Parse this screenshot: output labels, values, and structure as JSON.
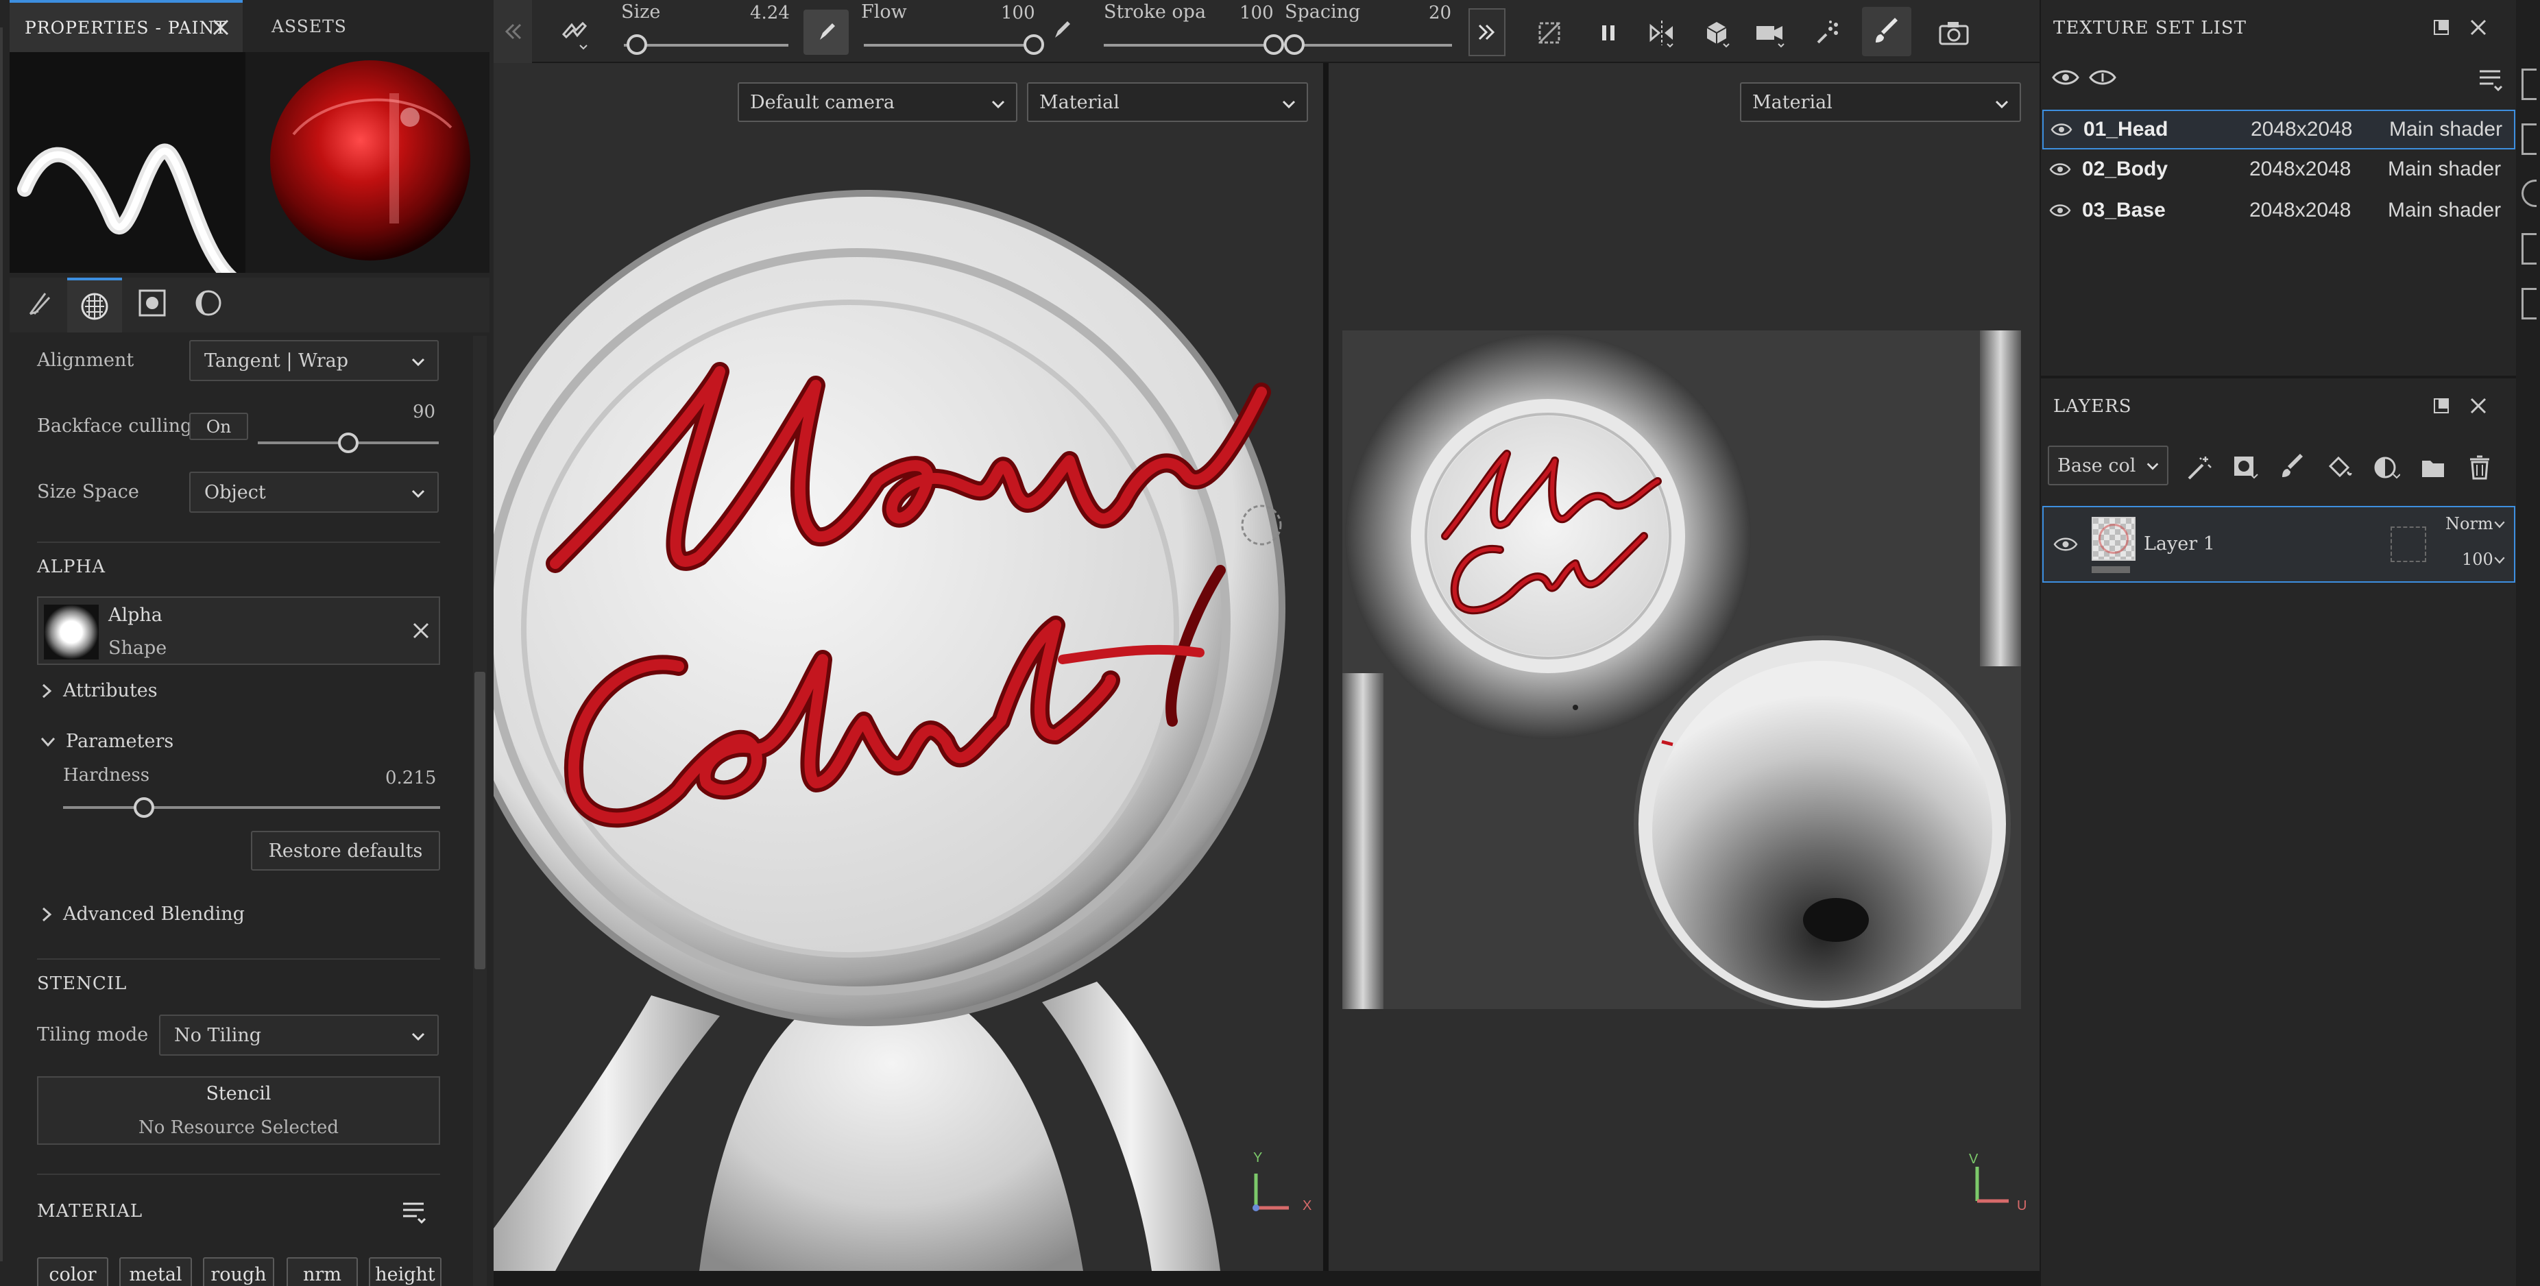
{
  "left_panel": {
    "tabs": {
      "properties": "PROPERTIES - PAINT",
      "assets": "ASSETS"
    },
    "alignment": {
      "label": "Alignment",
      "value": "Tangent | Wrap"
    },
    "backface": {
      "label": "Backface culling",
      "toggle": "On",
      "value": "90",
      "fraction": 0.5
    },
    "size_space": {
      "label": "Size Space",
      "value": "Object"
    },
    "alpha": {
      "header": "ALPHA",
      "name": "Alpha",
      "sub": "Shape",
      "attributes": "Attributes",
      "parameters": "Parameters",
      "hardness_label": "Hardness",
      "hardness_value": "0.215",
      "hardness_fraction": 0.215,
      "restore": "Restore defaults",
      "advanced": "Advanced Blending"
    },
    "stencil": {
      "header": "STENCIL",
      "tiling_label": "Tiling mode",
      "tiling_value": "No Tiling",
      "title": "Stencil",
      "sub": "No Resource Selected"
    },
    "material": {
      "header": "MATERIAL",
      "chips": [
        "color",
        "metal",
        "rough",
        "nrm",
        "height"
      ]
    }
  },
  "toolbar": {
    "size": {
      "label": "Size",
      "value": "4.24",
      "fraction": 0.08
    },
    "flow": {
      "label": "Flow",
      "value": "100",
      "fraction": 1.0
    },
    "stroke": {
      "label": "Stroke opa",
      "value": "100",
      "fraction": 1.0
    },
    "spacing": {
      "label": "Spacing",
      "value": "20",
      "fraction": 0.04
    }
  },
  "viewport3d": {
    "camera": "Default camera",
    "mode": "Material",
    "axis_y": "Y",
    "axis_x": "X"
  },
  "viewport2d": {
    "mode": "Material",
    "axis_v": "V",
    "axis_u": "U"
  },
  "texture_set_list": {
    "title": "TEXTURE SET LIST",
    "rows": [
      {
        "name": "01_Head",
        "res": "2048x2048",
        "shader": "Main shader"
      },
      {
        "name": "02_Body",
        "res": "2048x2048",
        "shader": "Main shader"
      },
      {
        "name": "03_Base",
        "res": "2048x2048",
        "shader": "Main shader"
      }
    ]
  },
  "layers": {
    "title": "LAYERS",
    "channel": "Base col",
    "layer_name": "Layer 1",
    "blend": "Norm",
    "opacity": "100"
  },
  "colors": {
    "accent": "#3d8fe0",
    "stroke_red": "#b0141c",
    "panel": "#252525"
  }
}
